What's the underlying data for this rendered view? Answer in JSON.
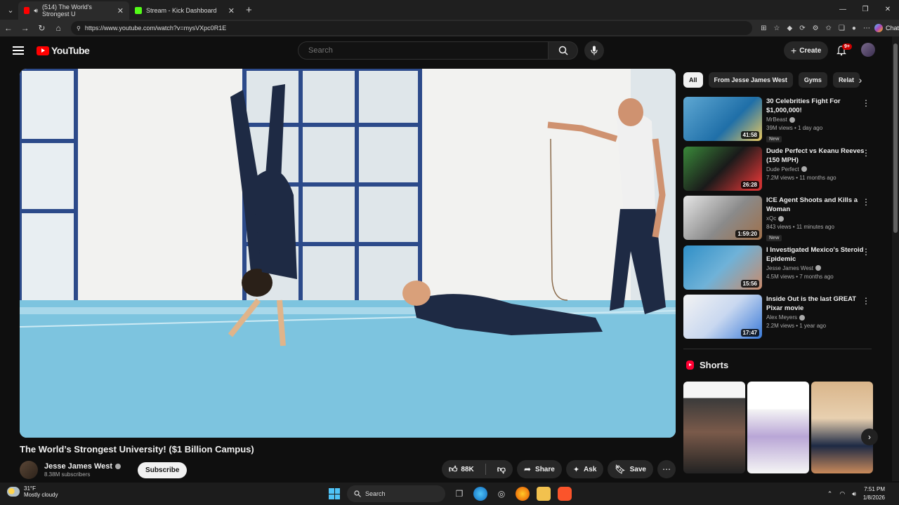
{
  "browser": {
    "tabs": [
      {
        "label": "(514) The World's Strongest U",
        "active": true
      },
      {
        "label": "Stream - Kick Dashboard",
        "active": false
      }
    ],
    "url": "https://www.youtube.com/watch?v=mysVXpc0R1E",
    "chat_label": "Chat"
  },
  "header": {
    "logo_text": "YouTube",
    "search_placeholder": "Search",
    "create_label": "Create",
    "notifications_badge": "9+"
  },
  "video": {
    "title": "The World’s Strongest University! ($1 Billion Campus)",
    "channel": "Jesse James West",
    "subscribers": "8.38M subscribers",
    "subscribe_label": "Subscribe",
    "likes": "88K",
    "share_label": "Share",
    "ask_label": "Ask",
    "save_label": "Save"
  },
  "chips": [
    "All",
    "From Jesse James West",
    "Gyms",
    "Relat"
  ],
  "recommendations": [
    {
      "title": "30 Celebrities Fight For $1,000,000!",
      "channel": "MrBeast",
      "stats": "39M views • 1 day ago",
      "duration": "41:58",
      "badge": "New"
    },
    {
      "title": "Dude Perfect vs Keanu Reeves (150 MPH)",
      "channel": "Dude Perfect",
      "stats": "7.2M views • 11 months ago",
      "duration": "26:28",
      "badge": ""
    },
    {
      "title": "ICE Agent Shoots and Kills a Woman",
      "channel": "xQc",
      "stats": "843 views • 11 minutes ago",
      "duration": "1:59:20",
      "badge": "New"
    },
    {
      "title": "I Investigated Mexico's Steroid Epidemic",
      "channel": "Jesse James West",
      "stats": "4.5M views • 7 months ago",
      "duration": "15:56",
      "badge": ""
    },
    {
      "title": "Inside Out is the last GREAT Pixar movie",
      "channel": "Alex Meyers",
      "stats": "2.2M views • 1 year ago",
      "duration": "17:47",
      "badge": ""
    }
  ],
  "shorts": {
    "heading": "Shorts"
  },
  "taskbar": {
    "temp": "31°F",
    "weather": "Mostly cloudy",
    "search_label": "Search",
    "time": "7:51 PM",
    "date": "1/8/2026"
  },
  "colors": {
    "accent": "#ff0000",
    "background": "#0f0f0f"
  }
}
